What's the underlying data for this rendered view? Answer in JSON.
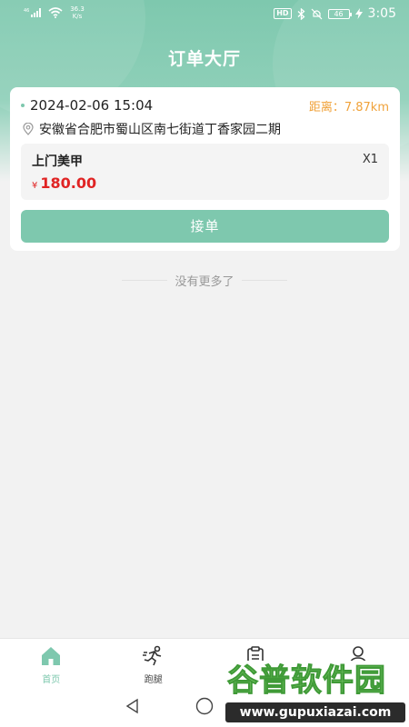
{
  "status_bar": {
    "network_speed": "36.3",
    "network_unit": "K/s",
    "signal_label": "46",
    "hd_label": "HD",
    "battery_label": "46",
    "time": "3:05"
  },
  "header": {
    "title": "订单大厅"
  },
  "order": {
    "datetime": "2024-02-06 15:04",
    "distance": "距离：7.87km",
    "address": "安徽省合肥市蜀山区南七街道丁香家园二期",
    "service_name": "上门美甲",
    "quantity": "X1",
    "currency": "¥",
    "price": "180.00",
    "accept_label": "接单"
  },
  "list_footer": {
    "no_more_text": "没有更多了"
  },
  "tabbar": {
    "items": [
      {
        "label": "首页",
        "icon": "home-icon",
        "active": true
      },
      {
        "label": "跑腿",
        "icon": "runner-icon",
        "active": false
      },
      {
        "label": "",
        "icon": "clipboard-icon",
        "active": false
      },
      {
        "label": "",
        "icon": "person-icon",
        "active": false
      }
    ]
  },
  "watermark": {
    "brand": "谷普软件园",
    "url": "www.gupuxiazai.com"
  },
  "colors": {
    "accent": "#7ec8ae",
    "price": "#e02424",
    "distance": "#f0a23a"
  }
}
